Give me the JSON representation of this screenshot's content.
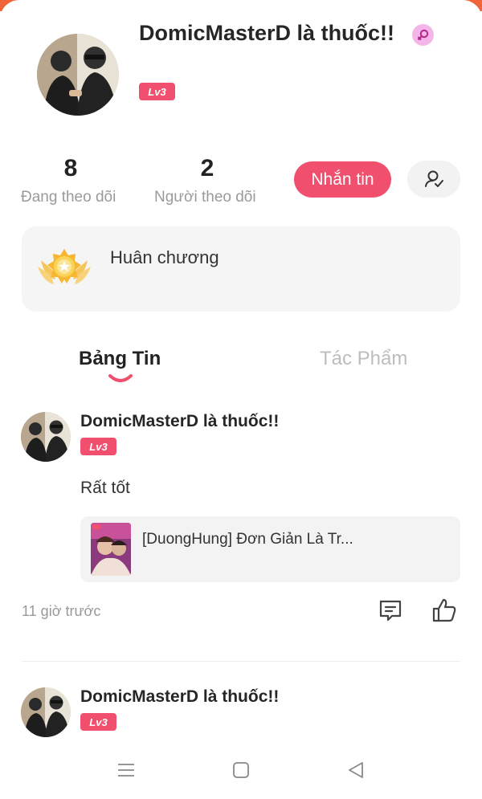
{
  "profile": {
    "name": "DomicMasterD là thuốc!!",
    "level": "Lv3",
    "gender_icon": "female-icon"
  },
  "stats": {
    "following_count": "8",
    "following_label": "Đang theo dõi",
    "followers_count": "2",
    "followers_label": "Người theo dõi"
  },
  "actions": {
    "message_label": "Nhắn tin",
    "follow_icon": "add-friend-icon"
  },
  "medal": {
    "label": "Huân chương",
    "icon": "medal-icon"
  },
  "tabs": [
    {
      "label": "Bảng Tin",
      "active": true
    },
    {
      "label": "Tác Phẩm",
      "active": false
    }
  ],
  "posts": [
    {
      "author": "DomicMasterD là thuốc!!",
      "level": "Lv3",
      "text": "Rất tốt",
      "shared_title": "[DuongHung] Đơn Giản Là Tr...",
      "time": "11 giờ trước"
    },
    {
      "author": "DomicMasterD là thuốc!!",
      "level": "Lv3"
    }
  ],
  "colors": {
    "accent": "#f0506e",
    "top_strip": "#f0643a"
  }
}
